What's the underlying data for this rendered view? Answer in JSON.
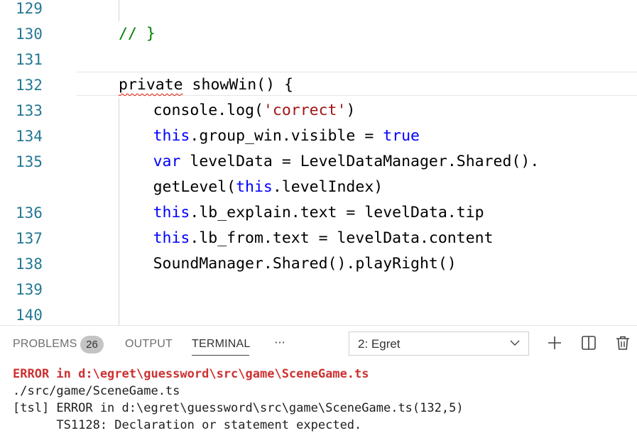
{
  "editor": {
    "line_numbers": [
      "129",
      "130",
      "131",
      "132",
      "133",
      "134",
      "135",
      "",
      "136",
      "137",
      "138",
      "139",
      "140"
    ],
    "lines": [
      [],
      [
        {
          "t": "// }",
          "c": "cmt"
        }
      ],
      [],
      [
        {
          "t": "private",
          "c": "squiggle"
        },
        {
          "t": " showWin() {",
          "c": ""
        }
      ],
      [
        {
          "t": "console.log(",
          "c": ""
        },
        {
          "t": "'correct'",
          "c": "str"
        },
        {
          "t": ")",
          "c": ""
        }
      ],
      [
        {
          "t": "this",
          "c": "kw"
        },
        {
          "t": ".group_win.visible = ",
          "c": ""
        },
        {
          "t": "true",
          "c": "kw"
        }
      ],
      [
        {
          "t": "var",
          "c": "kw"
        },
        {
          "t": " levelData = LevelDataManager.Shared().",
          "c": ""
        }
      ],
      [
        {
          "t": "getLevel(",
          "c": ""
        },
        {
          "t": "this",
          "c": "kw"
        },
        {
          "t": ".levelIndex)",
          "c": ""
        }
      ],
      [
        {
          "t": "this",
          "c": "kw"
        },
        {
          "t": ".lb_explain.text = levelData.tip",
          "c": ""
        }
      ],
      [
        {
          "t": "this",
          "c": "kw"
        },
        {
          "t": ".lb_from.text = levelData.content",
          "c": ""
        }
      ],
      [
        {
          "t": "SoundManager.Shared().playRight()",
          "c": ""
        }
      ],
      [],
      []
    ],
    "indent_levels": [
      1,
      1,
      0,
      1,
      2,
      2,
      2,
      2,
      2,
      2,
      2,
      1,
      1
    ]
  },
  "panel": {
    "tabs": [
      {
        "label": "PROBLEMS",
        "active": false
      },
      {
        "label": "OUTPUT",
        "active": false
      },
      {
        "label": "TERMINAL",
        "active": true
      }
    ],
    "problems_count": "26",
    "more_label": "···",
    "terminal_selector": {
      "selected": "2: Egret"
    },
    "actions": [
      {
        "icon": "plus-icon"
      },
      {
        "icon": "split-icon"
      },
      {
        "icon": "trash-icon"
      }
    ]
  },
  "terminal": {
    "lines": [
      {
        "text": "ERROR in d:\\egret\\guessword\\src\\game\\SceneGame.ts",
        "type": "error"
      },
      {
        "text": "./src/game/SceneGame.ts",
        "type": "normal"
      },
      {
        "text": "[tsl] ERROR in d:\\egret\\guessword\\src\\game\\SceneGame.ts(132,5)",
        "type": "normal"
      },
      {
        "text": "      TS1128: Declaration or statement expected.",
        "type": "normal"
      }
    ]
  },
  "colors": {
    "line_number": "#237893",
    "keyword": "#0000ff",
    "string": "#a31515",
    "comment": "#008000",
    "error": "#cd3131",
    "squiggle": "#e51400"
  }
}
